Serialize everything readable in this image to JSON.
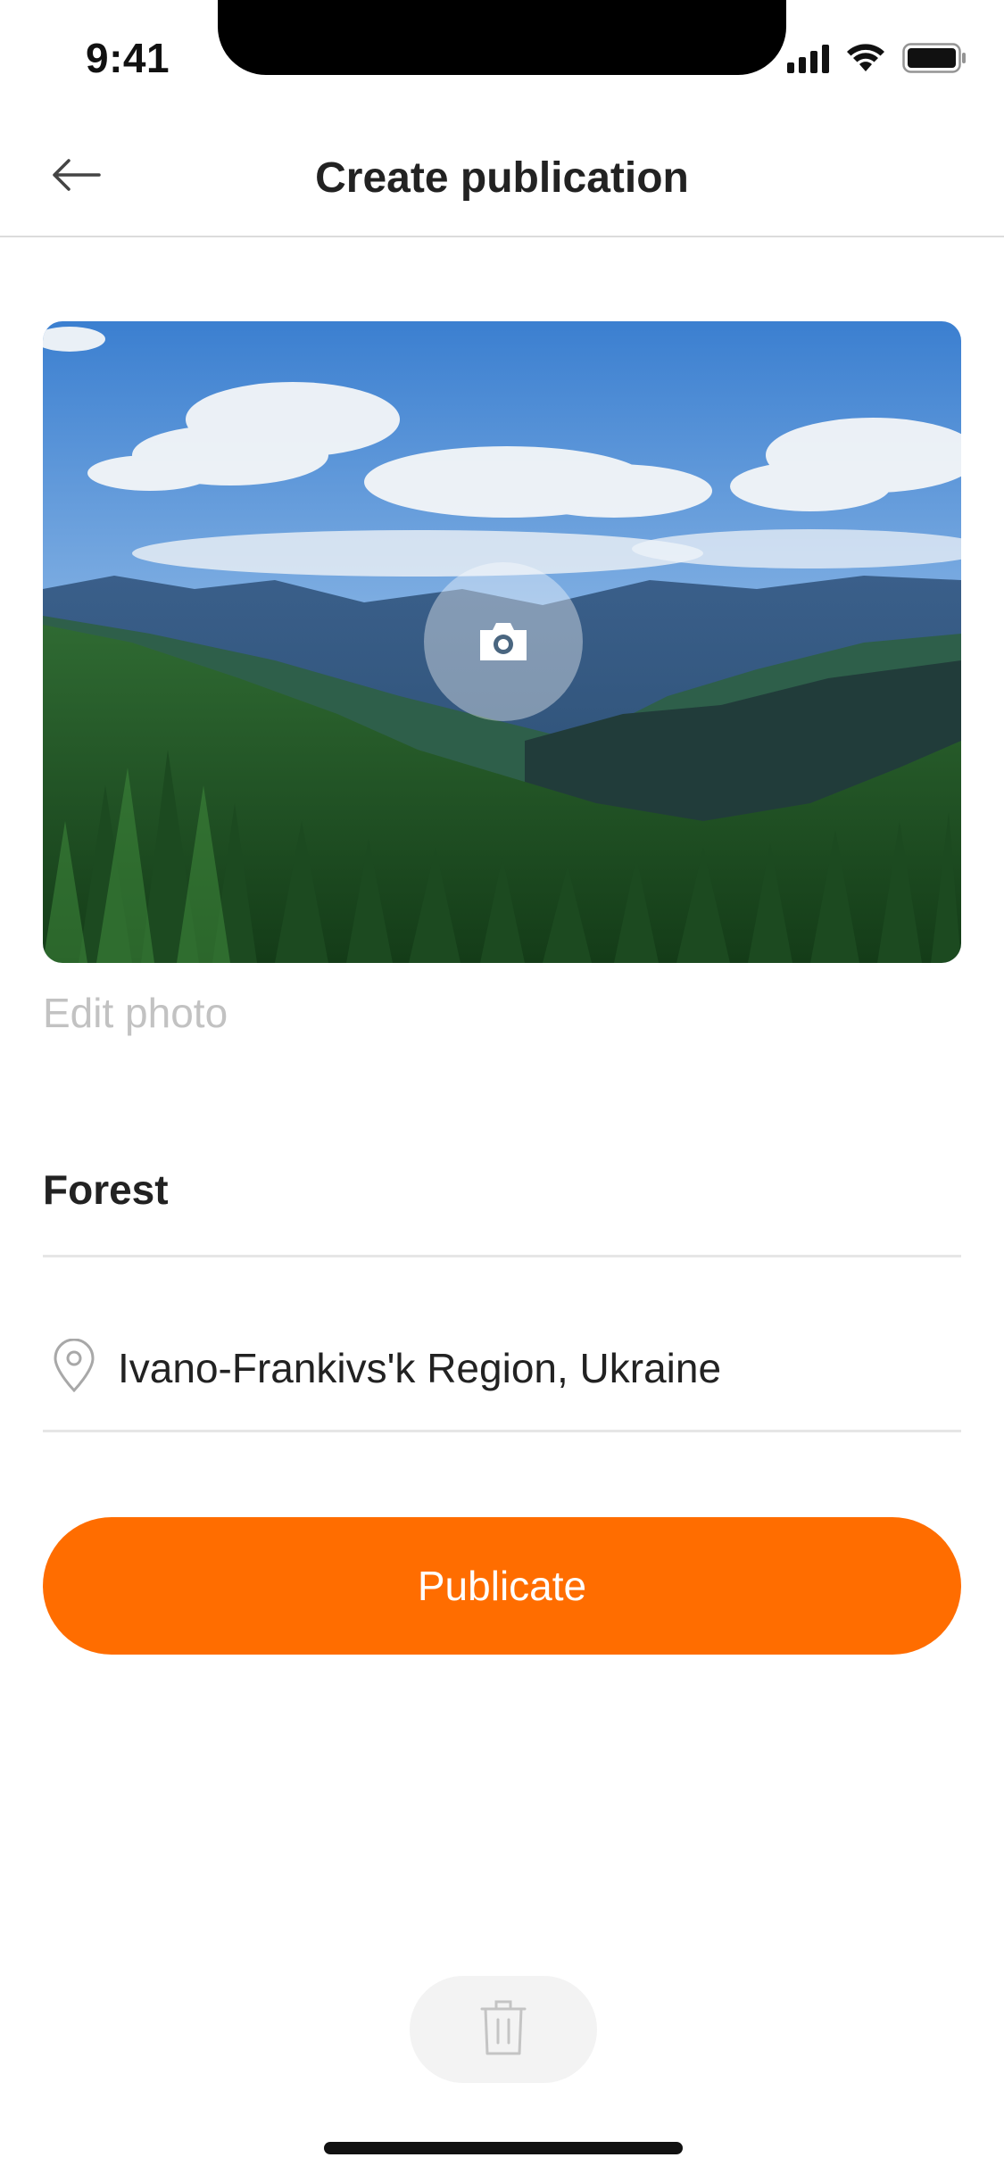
{
  "status_bar": {
    "time": "9:41",
    "icons": [
      "signal-icon",
      "wifi-icon",
      "battery-icon"
    ]
  },
  "header": {
    "back_icon": "arrow-left-icon",
    "title": "Create publication"
  },
  "photo": {
    "description_icon": "camera-icon"
  },
  "edit_photo_label": "Edit photo",
  "form": {
    "title_value": "Forest",
    "location_icon": "location-pin-icon",
    "location_value": "Ivano-Frankivs'k Region, Ukraine"
  },
  "publicate_label": "Publicate",
  "delete_icon": "trash-icon",
  "colors": {
    "accent": "#ff6d00",
    "muted_text": "#c2c2c2",
    "divider": "#e6e6e6"
  }
}
